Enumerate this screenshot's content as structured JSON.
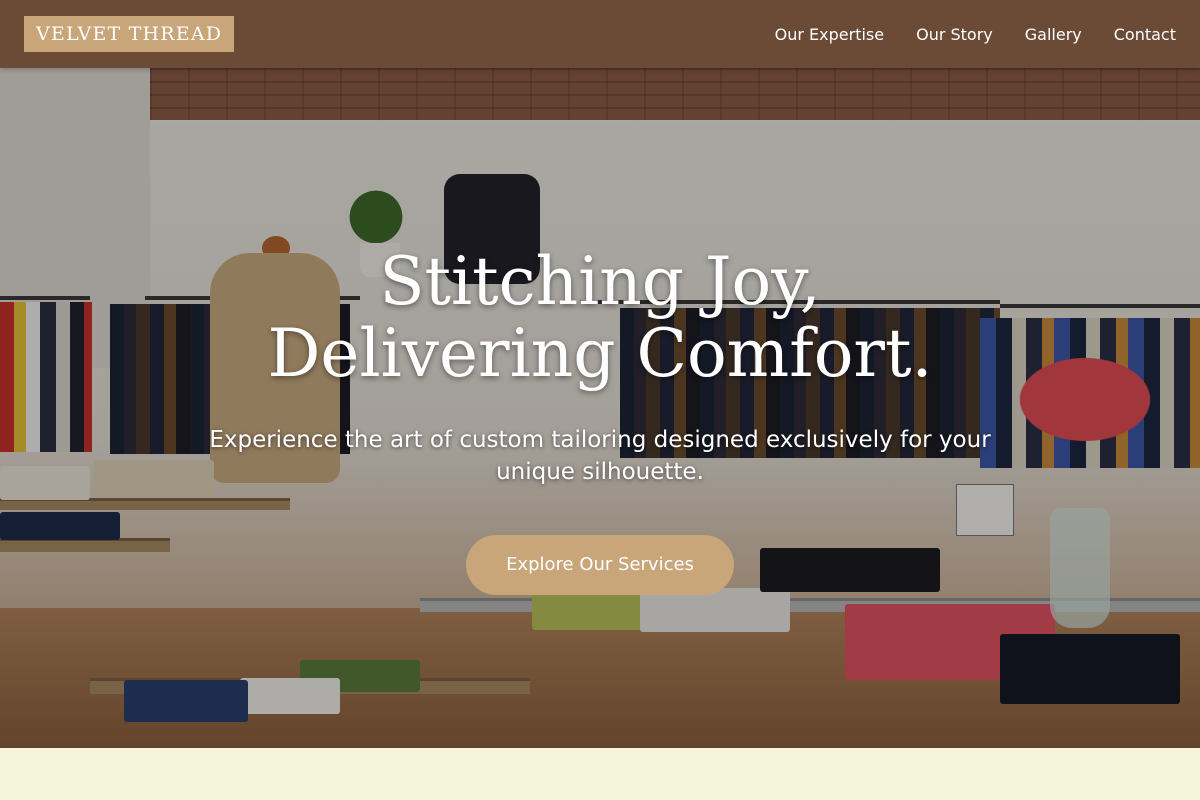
{
  "brand": {
    "name": "VELVET THREAD",
    "colors": {
      "header_bg": "#6b4a36",
      "accent": "#c9a57a",
      "page_bg": "#f5f5dc"
    }
  },
  "nav": {
    "items": [
      {
        "label": "Our Expertise"
      },
      {
        "label": "Our Story"
      },
      {
        "label": "Gallery"
      },
      {
        "label": "Contact"
      }
    ]
  },
  "hero": {
    "title": "Stitching Joy, Delivering Comfort.",
    "subtitle": "Experience the art of custom tailoring designed exclusively for your unique silhouette.",
    "cta_label": "Explore Our Services",
    "background_image": "clothing-boutique-interior"
  }
}
